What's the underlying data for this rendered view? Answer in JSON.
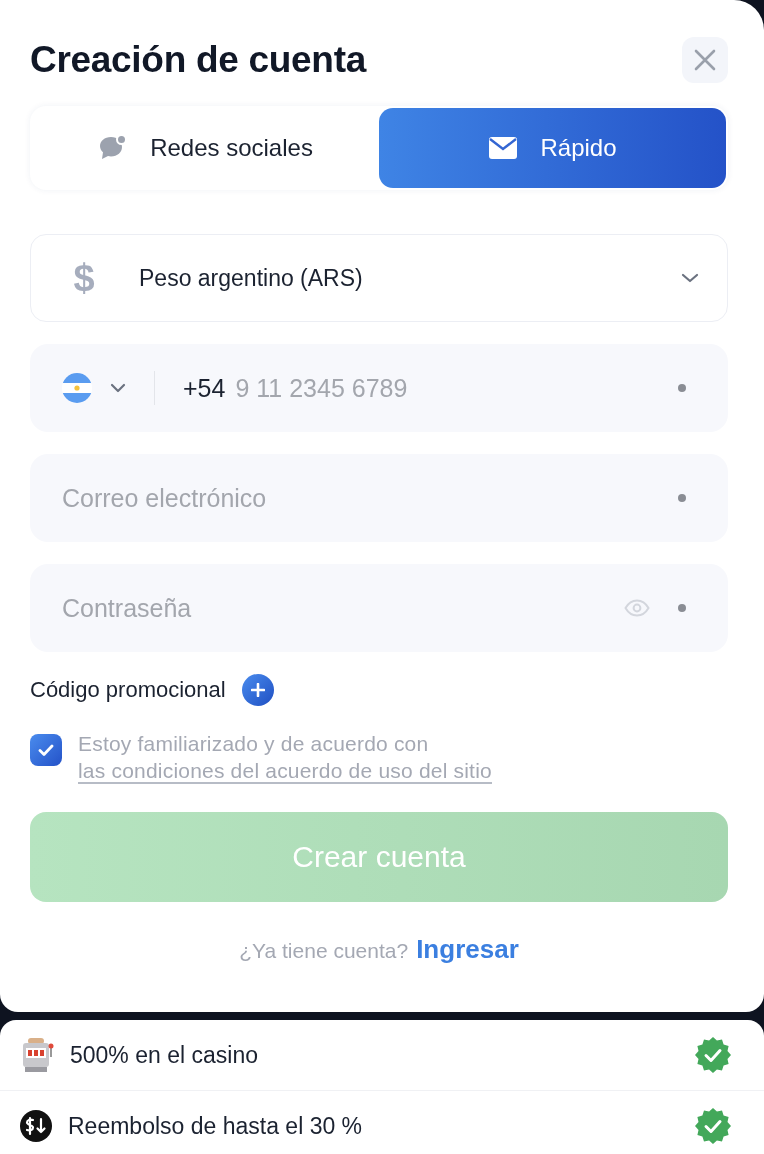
{
  "dialog": {
    "title": "Creación de cuenta"
  },
  "tabs": [
    {
      "label": "Redes sociales",
      "kind": "social",
      "selected": false
    },
    {
      "label": "Rápido",
      "kind": "quick",
      "selected": true
    }
  ],
  "currency": {
    "symbol": "$",
    "value": "Peso argentino (ARS)"
  },
  "phone": {
    "prefix": "+54",
    "placeholder": "9 11 2345 6789",
    "required": true
  },
  "email": {
    "placeholder": "Correo electrónico",
    "required": true
  },
  "password": {
    "placeholder": "Contraseña",
    "required": true
  },
  "promo": {
    "label": "Código promocional"
  },
  "agreement": {
    "text": "Estoy familiarizado y de acuerdo con",
    "link": "las condiciones del acuerdo de uso del sitio",
    "checked": true
  },
  "submit": {
    "label": "Crear cuenta",
    "disabled": true
  },
  "login": {
    "prompt": "¿Ya tiene cuenta?",
    "link": "Ingresar"
  },
  "bonuses": [
    {
      "kind": "slot",
      "text": "500% en el casino",
      "checked": true
    },
    {
      "kind": "cashback",
      "text": "Reembolso de hasta el 30 %",
      "checked": true
    }
  ]
}
